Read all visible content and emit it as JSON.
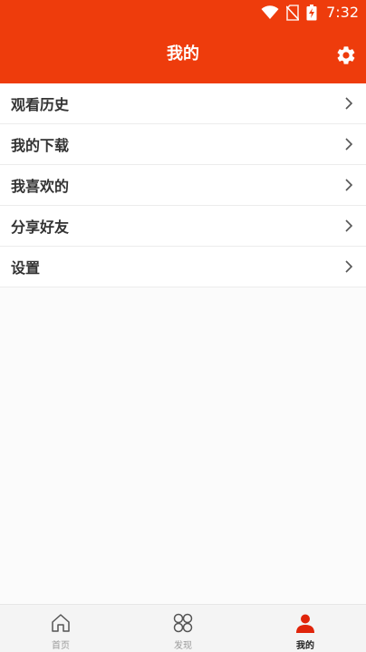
{
  "status_bar": {
    "time": "7:32",
    "icons": [
      "wifi-icon",
      "no-sim-icon",
      "battery-charging-icon"
    ]
  },
  "header": {
    "title": "我的",
    "settings_icon": "gear-icon"
  },
  "menu": {
    "items": [
      {
        "label": "观看历史"
      },
      {
        "label": "我的下载"
      },
      {
        "label": "我喜欢的"
      },
      {
        "label": "分享好友"
      },
      {
        "label": "设置"
      }
    ]
  },
  "tabbar": {
    "tabs": [
      {
        "label": "首页",
        "icon": "home-icon",
        "active": false
      },
      {
        "label": "发现",
        "icon": "discover-icon",
        "active": false
      },
      {
        "label": "我的",
        "icon": "user-icon",
        "active": true
      }
    ]
  },
  "colors": {
    "brand": "#ee3c0c",
    "active_icon": "#e0240a"
  }
}
